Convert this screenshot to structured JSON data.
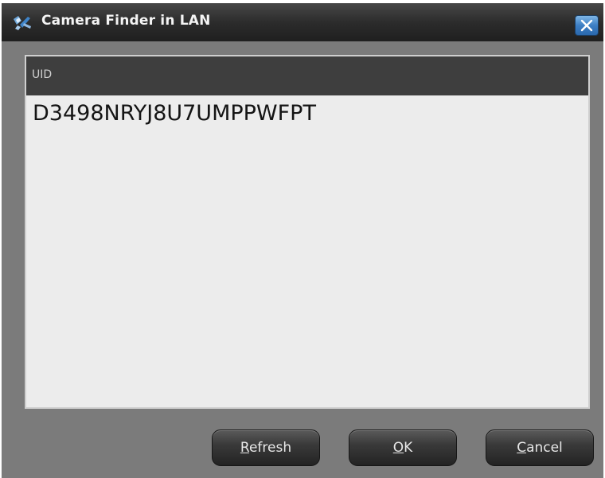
{
  "window": {
    "title": "Camera Finder in LAN",
    "app_icon": "camera-icon",
    "close_icon": "close-icon"
  },
  "list": {
    "header": "UID",
    "rows": [
      "D3498NRYJ8U7UMPPWFPT"
    ]
  },
  "buttons": {
    "refresh": {
      "mnemonic": "R",
      "rest": "efresh"
    },
    "ok": {
      "mnemonic": "O",
      "rest": "K"
    },
    "cancel": {
      "mnemonic": "C",
      "rest": "ancel"
    }
  },
  "colors": {
    "titlebar": "#2c2c2c",
    "window_body": "#7b7b7b",
    "list_background": "#ececec",
    "list_header": "#3e3e3e",
    "close_button": "#3d7fc4"
  }
}
